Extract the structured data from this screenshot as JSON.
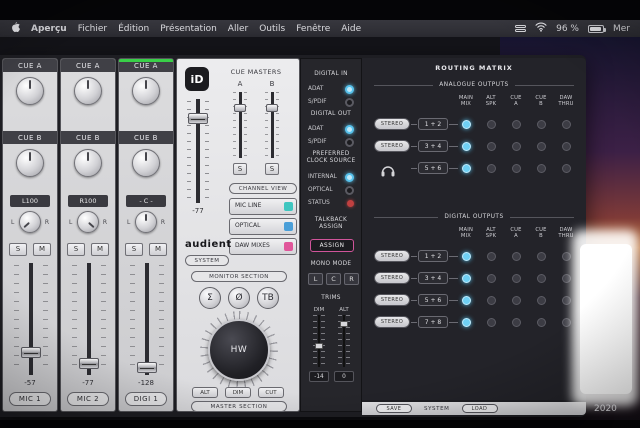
{
  "menu_bar": {
    "items": [
      "Aperçu",
      "Fichier",
      "Édition",
      "Présentation",
      "Aller",
      "Outils",
      "Fenêtre",
      "Aide"
    ],
    "status": {
      "battery": "96 %",
      "date": "Mer"
    }
  },
  "channels": [
    {
      "name": "MIC 1",
      "cue_a_label": "CUE A",
      "cue_b_label": "CUE B",
      "pan": "L100",
      "pan_left": "L",
      "pan_right": "R",
      "solo": "S",
      "mute": "M",
      "fader_value": "-57"
    },
    {
      "name": "MIC 2",
      "cue_a_label": "CUE A",
      "cue_b_label": "CUE B",
      "pan": "R100",
      "pan_left": "L",
      "pan_right": "R",
      "solo": "S",
      "mute": "M",
      "fader_value": "-77"
    },
    {
      "name": "DIGI 1",
      "cue_a_label": "CUE A",
      "cue_b_label": "CUE B",
      "pan": "- C -",
      "pan_left": "L",
      "pan_right": "R",
      "solo": "S",
      "mute": "M",
      "fader_value": "-128"
    }
  ],
  "master": {
    "logo": "iD",
    "cue_masters": {
      "title": "CUE MASTERS",
      "a": "A",
      "b": "B",
      "solo_a": "S",
      "solo_b": "S"
    },
    "main_fader_value": "-77",
    "channel_view": {
      "title": "CHANNEL VIEW",
      "buttons": [
        {
          "label": "MIC LINE",
          "color": "#3fc6c0"
        },
        {
          "label": "OPTICAL",
          "color": "#4a9fd8"
        },
        {
          "label": "DAW MIXES",
          "color": "#e0569a"
        }
      ]
    },
    "brand": "audient",
    "system_button": "SYSTEM",
    "monitor": {
      "title": "MONITOR SECTION",
      "sum": "Σ",
      "polarity": "Ø",
      "talkback": "TB",
      "knob_label": "HW",
      "alt": "ALT",
      "dim": "DIM",
      "cut": "CUT"
    },
    "footer": "MASTER SECTION"
  },
  "io_panel": {
    "digital_in": {
      "title": "DIGITAL IN",
      "options": [
        {
          "label": "ADAT",
          "on": true
        },
        {
          "label": "S/PDIF",
          "on": false
        }
      ]
    },
    "digital_out": {
      "title": "DIGITAL OUT",
      "options": [
        {
          "label": "ADAT",
          "on": true
        },
        {
          "label": "S/PDIF",
          "on": false
        }
      ]
    },
    "clock": {
      "title_line1": "PREFERRED",
      "title_line2": "CLOCK SOURCE",
      "options": [
        {
          "label": "INTERNAL",
          "on": true
        },
        {
          "label": "OPTICAL",
          "on": false
        }
      ],
      "status_label": "STATUS"
    },
    "talkback": {
      "title_line1": "TALKBACK",
      "title_line2": "ASSIGN",
      "button": "ASSIGN"
    },
    "mono_mode": {
      "title": "MONO MODE",
      "buttons": [
        "L",
        "C",
        "R"
      ]
    },
    "trims": {
      "title": "TRIMS",
      "sliders": [
        {
          "label": "DIM",
          "value": "-14"
        },
        {
          "label": "ALT",
          "value": "0"
        }
      ]
    }
  },
  "routing_matrix": {
    "title": "ROUTING MATRIX",
    "columns": [
      {
        "l1": "MAIN",
        "l2": "MIX"
      },
      {
        "l1": "ALT",
        "l2": "SPK"
      },
      {
        "l1": "CUE",
        "l2": "A"
      },
      {
        "l1": "CUE",
        "l2": "B"
      },
      {
        "l1": "DAW",
        "l2": "THRU"
      }
    ],
    "analogue": {
      "title": "ANALOGUE OUTPUTS",
      "rows": [
        {
          "pill": "STEREO",
          "label": "1 + 2",
          "selected": 0
        },
        {
          "pill": "STEREO",
          "label": "3 + 4",
          "selected": 0
        },
        {
          "pill": "",
          "icon": "headphones",
          "label": "5 + 6",
          "selected": 0
        }
      ]
    },
    "digital": {
      "title": "DIGITAL OUTPUTS",
      "rows": [
        {
          "pill": "STEREO",
          "label": "1 + 2",
          "selected": 0
        },
        {
          "pill": "STEREO",
          "label": "3 + 4",
          "selected": 0
        },
        {
          "pill": "STEREO",
          "label": "5 + 6",
          "selected": 0
        },
        {
          "pill": "STEREO",
          "label": "7 + 8",
          "selected": 0
        }
      ]
    },
    "footer": {
      "save": "SAVE",
      "system": "SYSTEM",
      "load": "LOAD"
    }
  },
  "overlay": {
    "partial_text": "2020"
  },
  "colors": {
    "accent_cyan": "#6fd0f4",
    "teal": "#3fc6c0",
    "blue": "#4a9fd8",
    "pink": "#e0569a",
    "signal_green": "#39d048",
    "status_red": "#c04040"
  }
}
